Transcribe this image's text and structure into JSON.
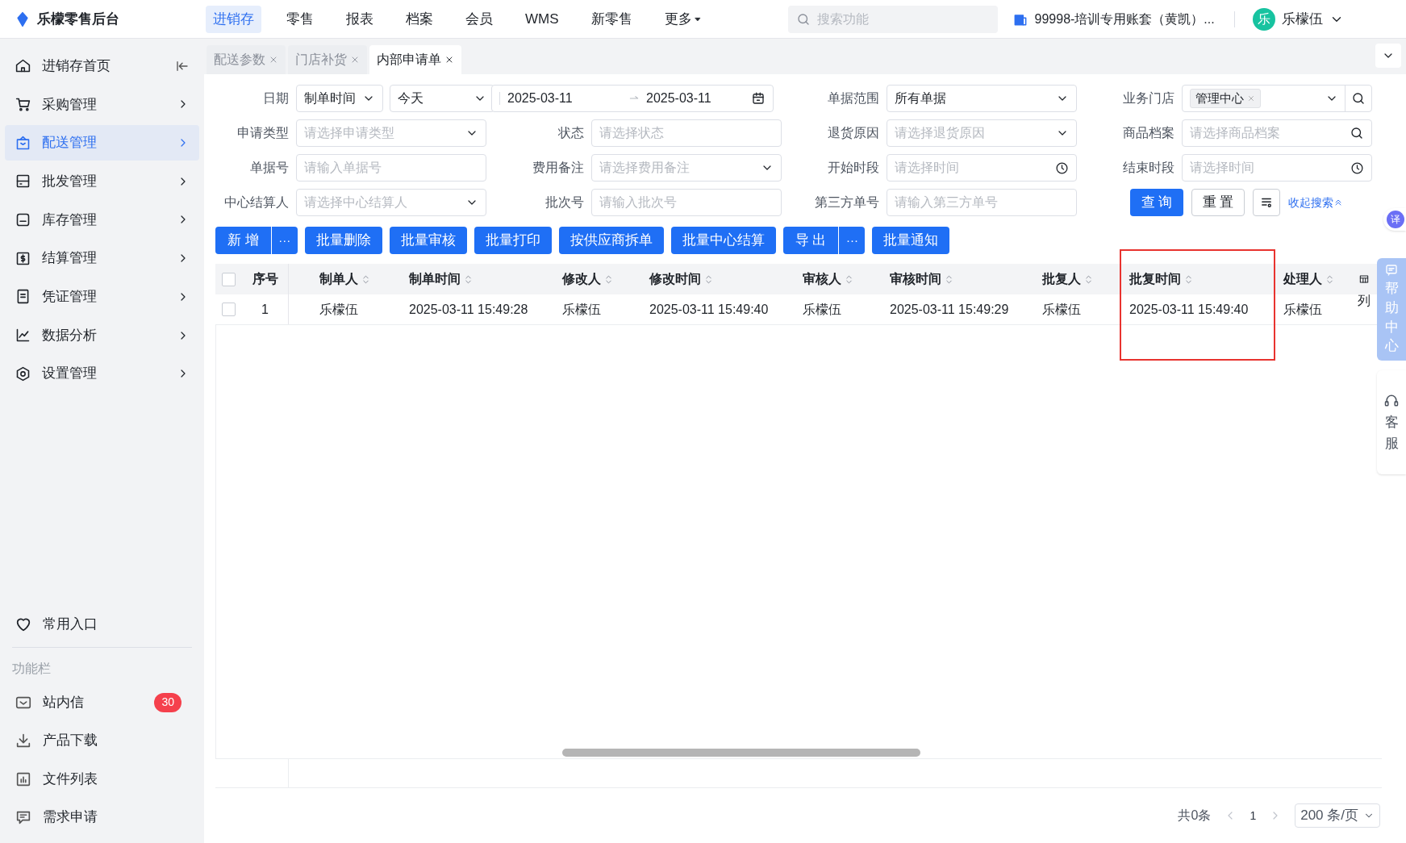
{
  "app": {
    "logo": "乐檬零售后台"
  },
  "top_nav": [
    {
      "label": "进销存",
      "selected": true,
      "kind": "link"
    },
    {
      "label": "零售",
      "selected": false,
      "kind": "link"
    },
    {
      "label": "报表",
      "selected": false,
      "kind": "link"
    },
    {
      "label": "档案",
      "selected": false,
      "kind": "link"
    },
    {
      "label": "会员",
      "selected": false,
      "kind": "link"
    },
    {
      "label": "WMS",
      "selected": false,
      "kind": "link"
    },
    {
      "label": "新零售",
      "selected": false,
      "kind": "link"
    },
    {
      "label": "更多",
      "selected": false,
      "kind": "dropdown"
    }
  ],
  "search": {
    "placeholder": "搜索功能"
  },
  "account": "99998-培训专用账套（黄凯）...",
  "user": {
    "avatar": "乐",
    "name": "乐檬伍"
  },
  "sidebar": {
    "items": [
      {
        "label": "进销存首页",
        "selected": false,
        "kind": "home"
      },
      {
        "label": "采购管理",
        "selected": false,
        "kind": "menu"
      },
      {
        "label": "配送管理",
        "selected": true,
        "kind": "menu"
      },
      {
        "label": "批发管理",
        "selected": false,
        "kind": "menu"
      },
      {
        "label": "库存管理",
        "selected": false,
        "kind": "menu"
      },
      {
        "label": "结算管理",
        "selected": false,
        "kind": "menu"
      },
      {
        "label": "凭证管理",
        "selected": false,
        "kind": "menu"
      },
      {
        "label": "数据分析",
        "selected": false,
        "kind": "menu"
      },
      {
        "label": "设置管理",
        "selected": false,
        "kind": "menu"
      }
    ],
    "favorites": "常用入口",
    "section_title": "功能栏",
    "tools": [
      {
        "label": "站内信",
        "badge": "30"
      },
      {
        "label": "产品下载"
      },
      {
        "label": "文件列表"
      },
      {
        "label": "需求申请"
      }
    ]
  },
  "tabs": [
    {
      "label": "配送参数",
      "selected": false
    },
    {
      "label": "门店补货",
      "selected": false
    },
    {
      "label": "内部申请单",
      "selected": true
    }
  ],
  "filters": [
    {
      "label": "日期",
      "kind": "date",
      "basis": "制单时间",
      "period": "今天",
      "start": "2025-03-11",
      "end": "2025-03-11"
    },
    {
      "label": "单据范围",
      "kind": "select",
      "value": "所有单据"
    },
    {
      "label": "业务门店",
      "kind": "tags",
      "tags": [
        "管理中心"
      ]
    },
    {
      "label": "申请类型",
      "kind": "select",
      "placeholder": "请选择申请类型"
    },
    {
      "label": "状态",
      "kind": "input",
      "placeholder": "请选择状态"
    },
    {
      "label": "退货原因",
      "kind": "select",
      "placeholder": "请选择退货原因"
    },
    {
      "label": "商品档案",
      "kind": "search",
      "placeholder": "请选择商品档案"
    },
    {
      "label": "单据号",
      "kind": "input",
      "placeholder": "请输入单据号"
    },
    {
      "label": "费用备注",
      "kind": "select",
      "placeholder": "请选择费用备注"
    },
    {
      "label": "开始时段",
      "kind": "time",
      "placeholder": "请选择时间"
    },
    {
      "label": "结束时段",
      "kind": "time",
      "placeholder": "请选择时间"
    },
    {
      "label": "中心结算人",
      "kind": "select",
      "placeholder": "请选择中心结算人"
    },
    {
      "label": "批次号",
      "kind": "input",
      "placeholder": "请输入批次号"
    },
    {
      "label": "第三方单号",
      "kind": "input",
      "placeholder": "请输入第三方单号"
    }
  ],
  "search_actions": {
    "query": "查 询",
    "reset": "重 置",
    "collapse": "收起搜索"
  },
  "toolbar": [
    {
      "label": "新 增",
      "kind": "split",
      "more": "···"
    },
    {
      "label": "批量删除",
      "kind": "plain"
    },
    {
      "label": "批量审核",
      "kind": "plain"
    },
    {
      "label": "批量打印",
      "kind": "plain"
    },
    {
      "label": "按供应商拆单",
      "kind": "plain"
    },
    {
      "label": "批量中心结算",
      "kind": "plain"
    },
    {
      "label": "导 出",
      "kind": "split",
      "more": "···"
    },
    {
      "label": "批量通知",
      "kind": "plain"
    }
  ],
  "table": {
    "all_checked": false,
    "columns": [
      {
        "label": "序号",
        "sortable": false,
        "highlighted": false
      },
      {
        "label": "制单人",
        "sortable": true,
        "highlighted": false
      },
      {
        "label": "制单时间",
        "sortable": true,
        "highlighted": false
      },
      {
        "label": "修改人",
        "sortable": true,
        "highlighted": false
      },
      {
        "label": "修改时间",
        "sortable": true,
        "highlighted": false
      },
      {
        "label": "审核人",
        "sortable": true,
        "highlighted": false
      },
      {
        "label": "审核时间",
        "sortable": true,
        "highlighted": false
      },
      {
        "label": "批复人",
        "sortable": true,
        "highlighted": false
      },
      {
        "label": "批复时间",
        "sortable": true,
        "highlighted": true
      },
      {
        "label": "处理人",
        "sortable": true,
        "highlighted": false
      }
    ],
    "rows": [
      {
        "checked": false,
        "cells": [
          "1",
          "乐檬伍",
          "2025-03-11 15:49:28",
          "乐檬伍",
          "2025-03-11 15:49:40",
          "乐檬伍",
          "2025-03-11 15:49:29",
          "乐檬伍",
          "2025-03-11 15:49:40",
          "乐檬伍"
        ]
      }
    ],
    "column_settings": "列"
  },
  "pagination": {
    "total": "共0条",
    "page": "1",
    "page_size": "200 条/页"
  },
  "float": {
    "translate": "译",
    "help": "帮助中心",
    "service": "客服"
  }
}
